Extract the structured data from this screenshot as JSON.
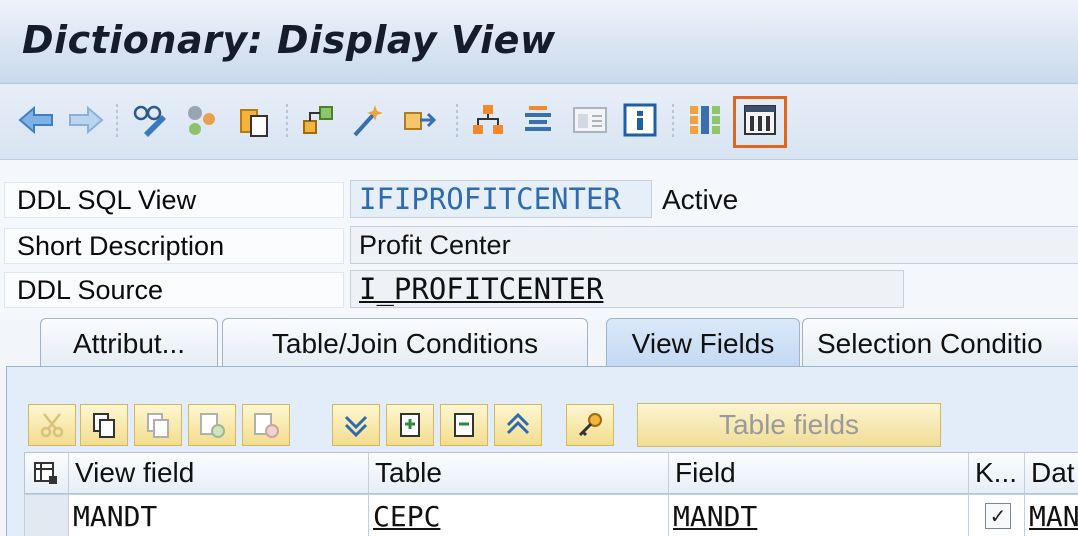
{
  "title": "Dictionary: Display View",
  "toolbar": {
    "icons": [
      "back-icon",
      "forward-icon",
      "display-change-icon",
      "other-object-icon",
      "activate-icon",
      "where-used-icon",
      "magic-wand-icon",
      "move-icon",
      "hierarchy-icon",
      "stack-icon",
      "dialog-icon",
      "info-icon",
      "layout-icon",
      "columns-icon"
    ]
  },
  "header": {
    "ddl_sql_view_label": "DDL SQL View",
    "ddl_sql_view_value": "IFIPROFITCENTER",
    "status": "Active",
    "short_description_label": "Short Description",
    "short_description_value": "Profit Center",
    "ddl_source_label": "DDL Source",
    "ddl_source_value": "I_PROFITCENTER"
  },
  "tabs": [
    {
      "label": "Attribut..."
    },
    {
      "label": "Table/Join Conditions"
    },
    {
      "label": "View Fields"
    },
    {
      "label": "Selection Conditio"
    }
  ],
  "table_toolbar": {
    "table_fields_label": "Table fields"
  },
  "table": {
    "columns": [
      "View field",
      "Table",
      "Field",
      "K...",
      "Dat"
    ],
    "rows": [
      {
        "view_field": "MANDT",
        "table": "CEPC",
        "field": "MANDT",
        "key": true,
        "data_element": "MAN"
      }
    ]
  },
  "colors": {
    "highlight": "#e0651e"
  }
}
